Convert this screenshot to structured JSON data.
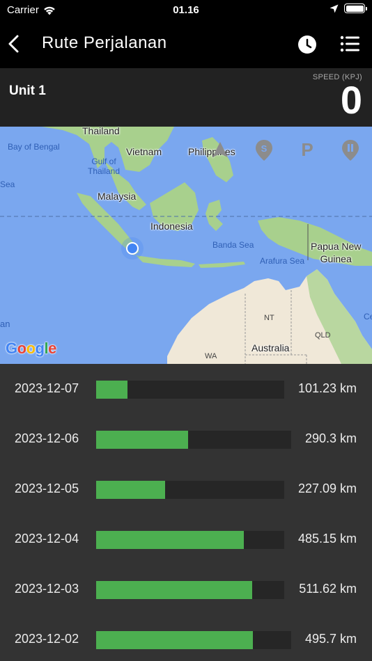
{
  "status_bar": {
    "carrier": "Carrier",
    "time": "01.16"
  },
  "nav": {
    "title": "Rute Perjalanan",
    "icons": [
      "back-chevron-icon",
      "clock-icon",
      "list-icon"
    ]
  },
  "unit": {
    "name": "Unit 1",
    "speed_label": "SPEED (KPJ)",
    "speed_value": "0"
  },
  "map": {
    "labels": {
      "thailand": "Thailand",
      "vietnam": "Vietnam",
      "philippines": "Philippines",
      "malaysia": "Malaysia",
      "indonesia": "Indonesia",
      "papua": "Papua New\nGuinea",
      "australia": "Australia",
      "bay_of_bengal": "Bay of Bengal",
      "gulf_of_thailand": "Gulf of\nThailand",
      "banda_sea": "Banda Sea",
      "arafura_sea": "Arafura Sea",
      "sea_left": "Sea",
      "an_left": "an",
      "nt": "NT",
      "qld": "QLD",
      "wa": "WA",
      "ce_right": "Ce"
    },
    "logo": "Google",
    "markers": [
      "person-marker-icon",
      "s-marker-icon",
      "p-marker-icon",
      "pause-marker-icon"
    ]
  },
  "trips": [
    {
      "date": "2023-12-07",
      "distance": "101.23 km",
      "fill": 0.165
    },
    {
      "date": "2023-12-06",
      "distance": "290.3 km",
      "fill": 0.47
    },
    {
      "date": "2023-12-05",
      "distance": "227.09 km",
      "fill": 0.368
    },
    {
      "date": "2023-12-04",
      "distance": "485.15 km",
      "fill": 0.787
    },
    {
      "date": "2023-12-03",
      "distance": "511.62 km",
      "fill": 0.83
    },
    {
      "date": "2023-12-02",
      "distance": "495.7 km",
      "fill": 0.804
    }
  ],
  "colors": {
    "accent_bar": "#4caf50",
    "background": "#333333",
    "header": "#000000"
  }
}
